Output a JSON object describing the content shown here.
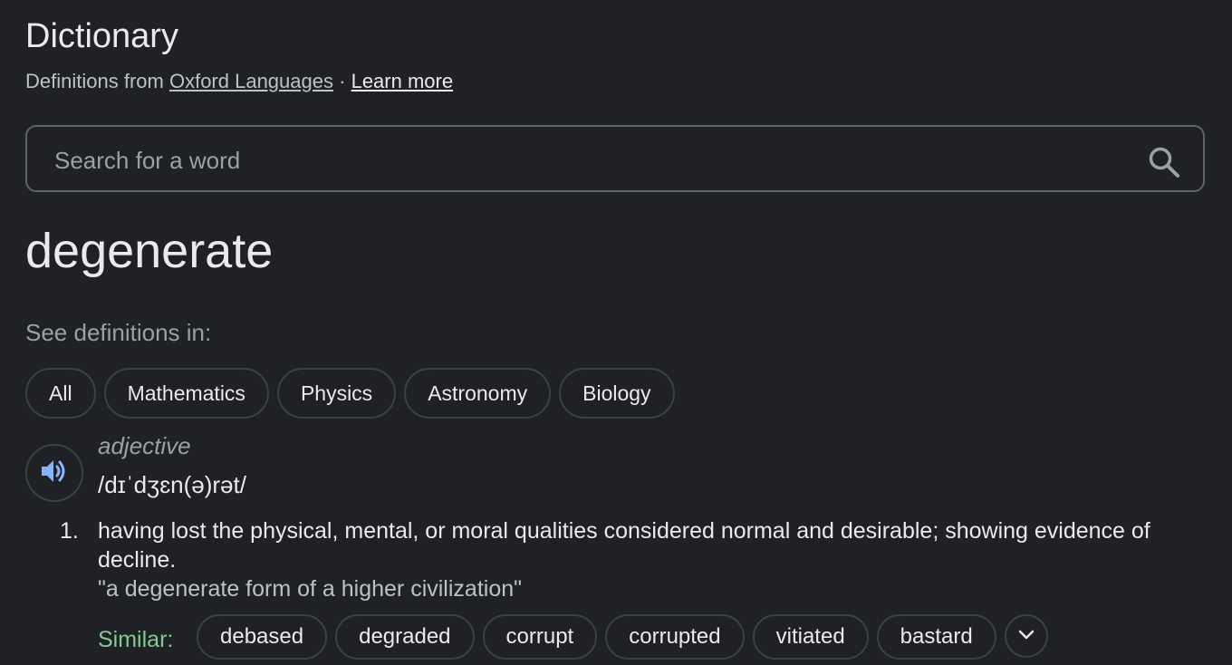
{
  "header": {
    "title": "Dictionary",
    "source_prefix": "Definitions from",
    "source_link": "Oxford Languages",
    "separator": "·",
    "learn_more": "Learn more"
  },
  "search": {
    "placeholder": "Search for a word",
    "value": "",
    "icon": "search-icon"
  },
  "entry": {
    "word": "degenerate",
    "see_definitions_label": "See definitions in:",
    "filters": [
      "All",
      "Mathematics",
      "Physics",
      "Astronomy",
      "Biology"
    ],
    "speaker_icon": "speaker-icon",
    "part_of_speech": "adjective",
    "pronunciation": "/dɪˈdʒɛn(ə)rət/",
    "definitions": [
      {
        "number": "1.",
        "text": "having lost the physical, mental, or moral qualities considered normal and desirable; showing evidence of decline.",
        "example": "\"a degenerate form of a higher civilization\"",
        "similar_label": "Similar:",
        "similar": [
          "debased",
          "degraded",
          "corrupt",
          "corrupted",
          "vitiated",
          "bastard"
        ]
      }
    ]
  },
  "colors": {
    "background": "#202124",
    "text_primary": "#e8eaed",
    "text_secondary": "#9aa0a6",
    "border": "#3c4043",
    "similar_green": "#81c995",
    "speaker_blue": "#8ab4f8"
  }
}
